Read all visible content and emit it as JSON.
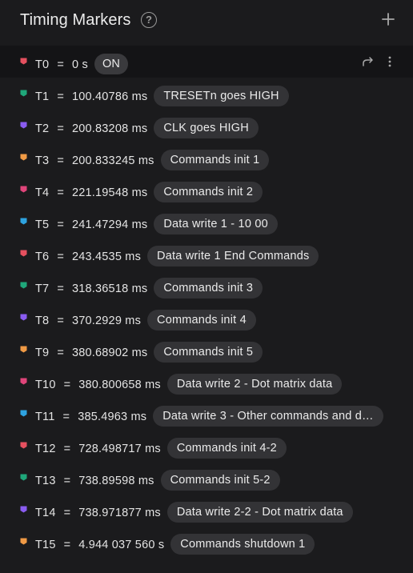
{
  "panel": {
    "title": "Timing Markers",
    "help_icon": "?",
    "add_icon": "plus-icon"
  },
  "markers": [
    {
      "id": "T0",
      "time": "0 s",
      "note": "ON",
      "color": "#e5505f"
    },
    {
      "id": "T1",
      "time": "100.40786 ms",
      "note": "TRESETn goes HIGH",
      "color": "#1fa77a"
    },
    {
      "id": "T2",
      "time": "200.83208 ms",
      "note": "CLK goes HIGH",
      "color": "#8a5cf0"
    },
    {
      "id": "T3",
      "time": "200.833245 ms",
      "note": "Commands init 1",
      "color": "#f09a45"
    },
    {
      "id": "T4",
      "time": "221.19548 ms",
      "note": "Commands init 2",
      "color": "#e0457a"
    },
    {
      "id": "T5",
      "time": "241.47294 ms",
      "note": "Data write 1 - 10 00",
      "color": "#2ea3e0"
    },
    {
      "id": "T6",
      "time": "243.4535 ms",
      "note": "Data write 1 End Commands",
      "color": "#e5505f"
    },
    {
      "id": "T7",
      "time": "318.36518 ms",
      "note": "Commands init 3",
      "color": "#1fa77a"
    },
    {
      "id": "T8",
      "time": "370.2929 ms",
      "note": "Commands init 4",
      "color": "#8a5cf0"
    },
    {
      "id": "T9",
      "time": "380.68902 ms",
      "note": "Commands init 5",
      "color": "#f09a45"
    },
    {
      "id": "T10",
      "time": "380.800658 ms",
      "note": "Data write 2 - Dot matrix data",
      "color": "#e0457a"
    },
    {
      "id": "T11",
      "time": "385.4963 ms",
      "note": "Data write 3 - Other commands and d…",
      "color": "#2ea3e0"
    },
    {
      "id": "T12",
      "time": "728.498717 ms",
      "note": "Commands init 4-2",
      "color": "#e5505f"
    },
    {
      "id": "T13",
      "time": "738.89598 ms",
      "note": "Commands init 5-2",
      "color": "#1fa77a"
    },
    {
      "id": "T14",
      "time": "738.971877 ms",
      "note": "Data write 2-2 - Dot matrix data",
      "color": "#8a5cf0"
    },
    {
      "id": "T15",
      "time": "4.944 037 560 s",
      "note": "Commands shutdown 1",
      "color": "#f09a45"
    }
  ],
  "selected_row_actions": [
    "share-icon",
    "more-vertical-icon"
  ],
  "separator": "="
}
